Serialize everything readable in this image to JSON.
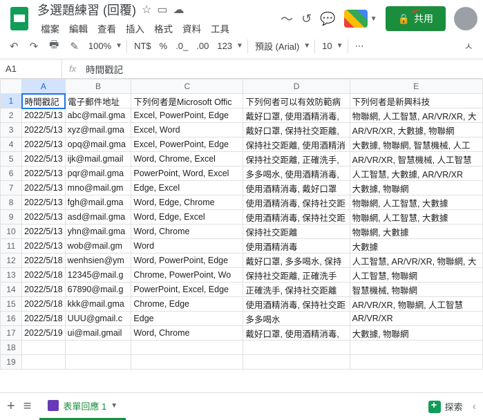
{
  "doc": {
    "title": "多選題練習 (回覆)"
  },
  "menu": [
    "檔案",
    "編輯",
    "查看",
    "插入",
    "格式",
    "資料",
    "工具"
  ],
  "share": "共用",
  "toolbar": {
    "zoom": "100%",
    "currency": "NT$",
    "numfmt": "123",
    "font": "預設 (Arial)",
    "fontsize": "10"
  },
  "namebox": "A1",
  "formula": "時間戳記",
  "cols": [
    "A",
    "B",
    "C",
    "D",
    "E"
  ],
  "headers": [
    "時間戳記",
    "電子郵件地址",
    "下列何者是Microsoft Offic",
    "下列何者可以有效防範病",
    "下列何者是新興科技"
  ],
  "rows": [
    [
      "2022/5/13",
      "abc@mail.gma",
      "Excel, PowerPoint, Edge",
      "戴好口罩, 使用酒精消毒,",
      "物聯網, 人工智慧, AR/VR/XR, 大"
    ],
    [
      "2022/5/13",
      "xyz@mail.gma",
      "Excel, Word",
      "戴好口罩, 保持社交距離,",
      "AR/VR/XR, 大數據, 物聯網"
    ],
    [
      "2022/5/13",
      "opq@mail.gma",
      "Excel, PowerPoint, Edge",
      "保持社交距離, 使用酒精消",
      "大數據, 物聯網, 智慧機械, 人工"
    ],
    [
      "2022/5/13",
      "ijk@mail.gmail",
      "Word, Chrome, Excel",
      "保持社交距離, 正確洗手,",
      "AR/VR/XR, 智慧機械, 人工智慧"
    ],
    [
      "2022/5/13",
      "pqr@mail.gma",
      "PowerPoint, Word, Excel",
      "多多喝水, 使用酒精消毒,",
      "人工智慧, 大數據, AR/VR/XR"
    ],
    [
      "2022/5/13",
      "mno@mail.gm",
      "Edge, Excel",
      "使用酒精消毒, 戴好口罩",
      "大數據, 物聯網"
    ],
    [
      "2022/5/13",
      "fgh@mail.gma",
      "Word, Edge, Chrome",
      "使用酒精消毒, 保持社交距",
      "物聯網, 人工智慧, 大數據"
    ],
    [
      "2022/5/13",
      "asd@mail.gma",
      "Word, Edge, Excel",
      "使用酒精消毒, 保持社交距",
      "物聯網, 人工智慧, 大數據"
    ],
    [
      "2022/5/13",
      "yhn@mail.gma",
      "Word, Chrome",
      "保持社交距離",
      "物聯網, 大數據"
    ],
    [
      "2022/5/13",
      "wob@mail.gm",
      "Word",
      "使用酒精消毒",
      "大數據"
    ],
    [
      "2022/5/18",
      "wenhsien@ym",
      "Word, PowerPoint, Edge",
      "戴好口罩, 多多喝水, 保持",
      "人工智慧, AR/VR/XR, 物聯網, 大"
    ],
    [
      "2022/5/18",
      "12345@mail.g",
      "Chrome, PowerPoint, Wo",
      "保持社交距離, 正確洗手",
      "人工智慧, 物聯網"
    ],
    [
      "2022/5/18",
      "67890@mail.g",
      "PowerPoint, Excel, Edge",
      "正確洗手, 保持社交距離",
      "智慧機械, 物聯網"
    ],
    [
      "2022/5/18",
      "kkk@mail.gma",
      "Chrome, Edge",
      "使用酒精消毒, 保持社交距",
      "AR/VR/XR, 物聯網, 人工智慧"
    ],
    [
      "2022/5/18",
      "UUU@gmail.c",
      "Edge",
      "多多喝水",
      "AR/VR/XR"
    ],
    [
      "2022/5/19",
      "ui@mail.gmail",
      "Word, Chrome",
      "戴好口罩, 使用酒精消毒,",
      "大數據, 物聯網"
    ]
  ],
  "sheettab": "表單回應 1",
  "explore": "探索"
}
